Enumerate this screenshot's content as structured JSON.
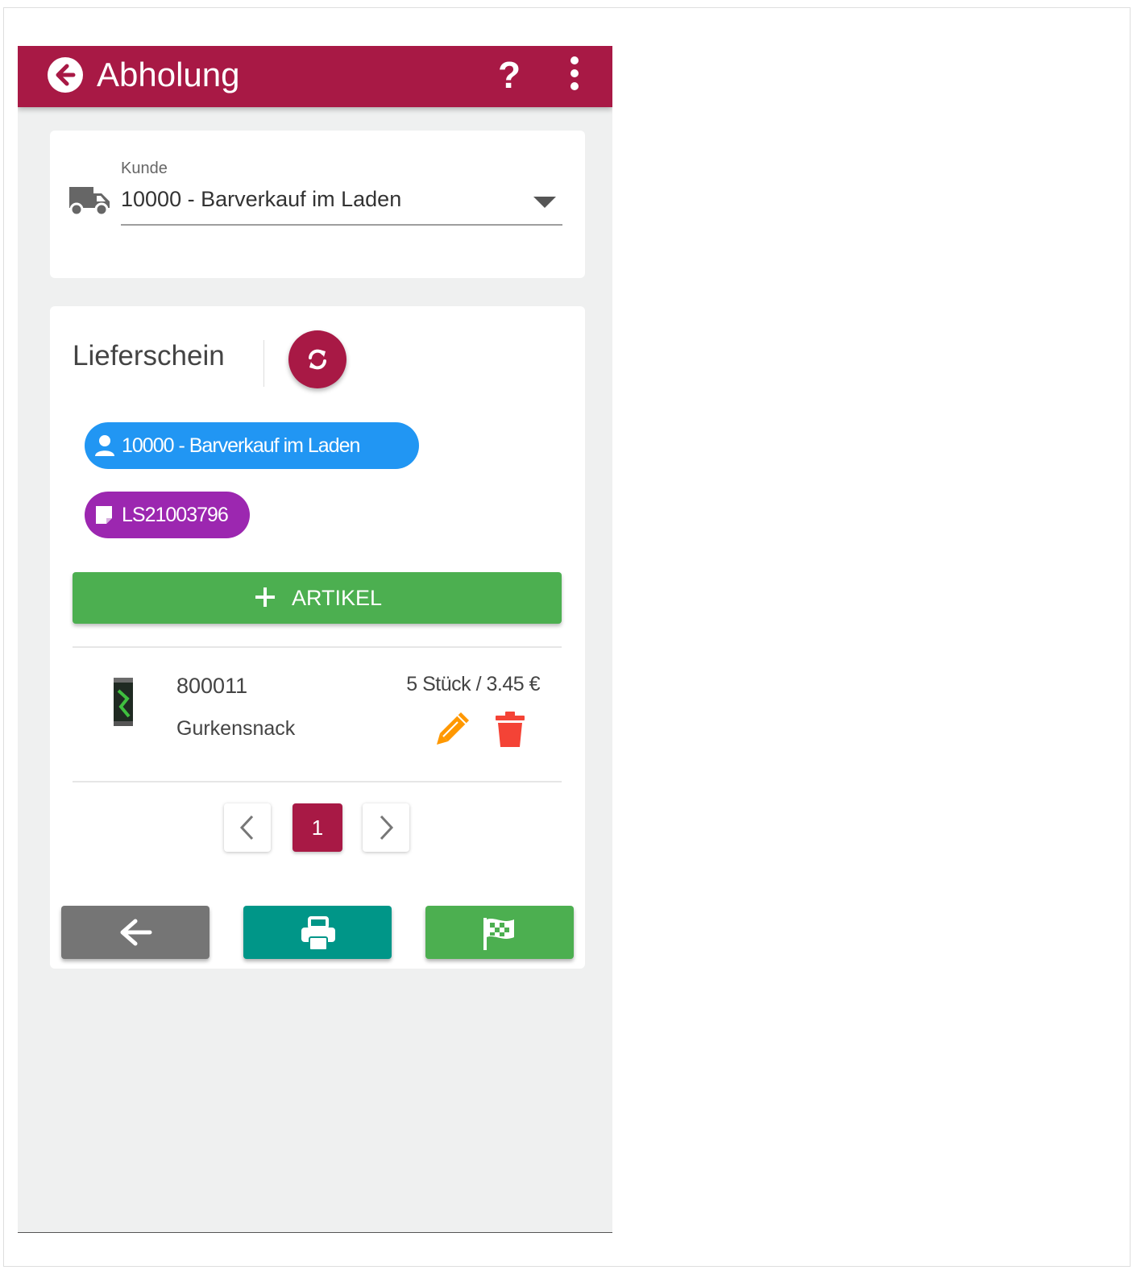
{
  "appbar": {
    "title": "Abholung",
    "back_icon": "arrow-circle-left-icon",
    "help_label": "?",
    "menu_icon": "more-vertical-icon",
    "color": "#a81945"
  },
  "customer_card": {
    "icon": "truck-icon",
    "field_label": "Kunde",
    "selected_value": "10000 - Barverkauf im Laden"
  },
  "delivery_note": {
    "title": "Lieferschein",
    "refresh_icon": "refresh-icon",
    "customer_chip": {
      "icon": "user-icon",
      "label": "10000 - Barverkauf im Laden",
      "color": "#2196f3"
    },
    "document_chip": {
      "icon": "note-icon",
      "label": "LS21003796",
      "color": "#9c27b0"
    },
    "add_button": {
      "icon": "plus-icon",
      "label": "ARTIKEL",
      "color": "#4caf50"
    },
    "items": [
      {
        "number": "800011",
        "name": "Gurkensnack",
        "quantity_price": "5 Stück / 3.45 €",
        "edit_icon": "pencil-icon",
        "delete_icon": "trash-icon"
      }
    ],
    "pagination": {
      "current_page": "1",
      "prev_icon": "chevron-left-icon",
      "next_icon": "chevron-right-icon"
    }
  },
  "actions": [
    {
      "name": "back",
      "icon": "arrow-left-icon",
      "color": "#757575"
    },
    {
      "name": "print",
      "icon": "printer-icon",
      "color": "#009688"
    },
    {
      "name": "finish",
      "icon": "checkered-flag-icon",
      "color": "#4caf50"
    }
  ]
}
